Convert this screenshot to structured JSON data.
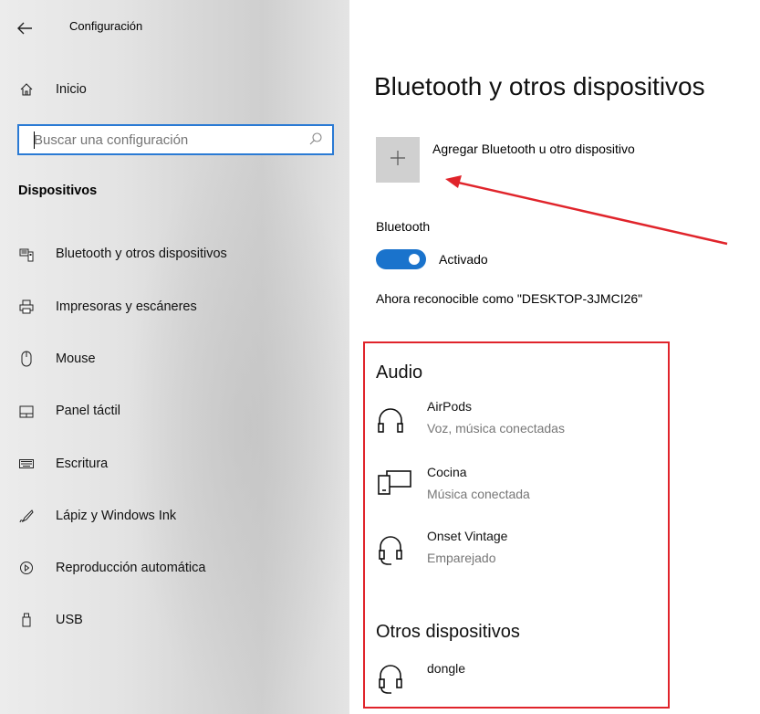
{
  "window": {
    "title": "Configuración"
  },
  "sidebar": {
    "home_label": "Inicio",
    "search": {
      "placeholder": "Buscar una configuración"
    },
    "section": "Dispositivos",
    "items": [
      {
        "label": "Bluetooth y otros dispositivos",
        "icon": "bluetooth-devices-icon"
      },
      {
        "label": "Impresoras y escáneres",
        "icon": "printer-icon"
      },
      {
        "label": "Mouse",
        "icon": "mouse-icon"
      },
      {
        "label": "Panel táctil",
        "icon": "touchpad-icon"
      },
      {
        "label": "Escritura",
        "icon": "keyboard-icon"
      },
      {
        "label": "Lápiz y Windows Ink",
        "icon": "pen-icon"
      },
      {
        "label": "Reproducción automática",
        "icon": "autoplay-icon"
      },
      {
        "label": "USB",
        "icon": "usb-icon"
      }
    ]
  },
  "main": {
    "title": "Bluetooth y otros dispositivos",
    "add_device_label": "Agregar Bluetooth u otro dispositivo",
    "bluetooth_label": "Bluetooth",
    "toggle_state": "Activado",
    "discoverable_text": "Ahora reconocible como \"DESKTOP-3JMCI26\"",
    "audio": {
      "title": "Audio",
      "devices": [
        {
          "name": "AirPods",
          "status": "Voz, música conectadas",
          "icon": "headphones-icon"
        },
        {
          "name": "Cocina",
          "status": "Música conectada",
          "icon": "speaker-device-icon"
        },
        {
          "name": "Onset Vintage",
          "status": "Emparejado",
          "icon": "headset-icon"
        }
      ]
    },
    "other": {
      "title": "Otros dispositivos",
      "devices": [
        {
          "name": "dongle",
          "icon": "headset-icon"
        }
      ]
    }
  },
  "colors": {
    "accent": "#1a73cc",
    "annotation": "#e0242b"
  }
}
